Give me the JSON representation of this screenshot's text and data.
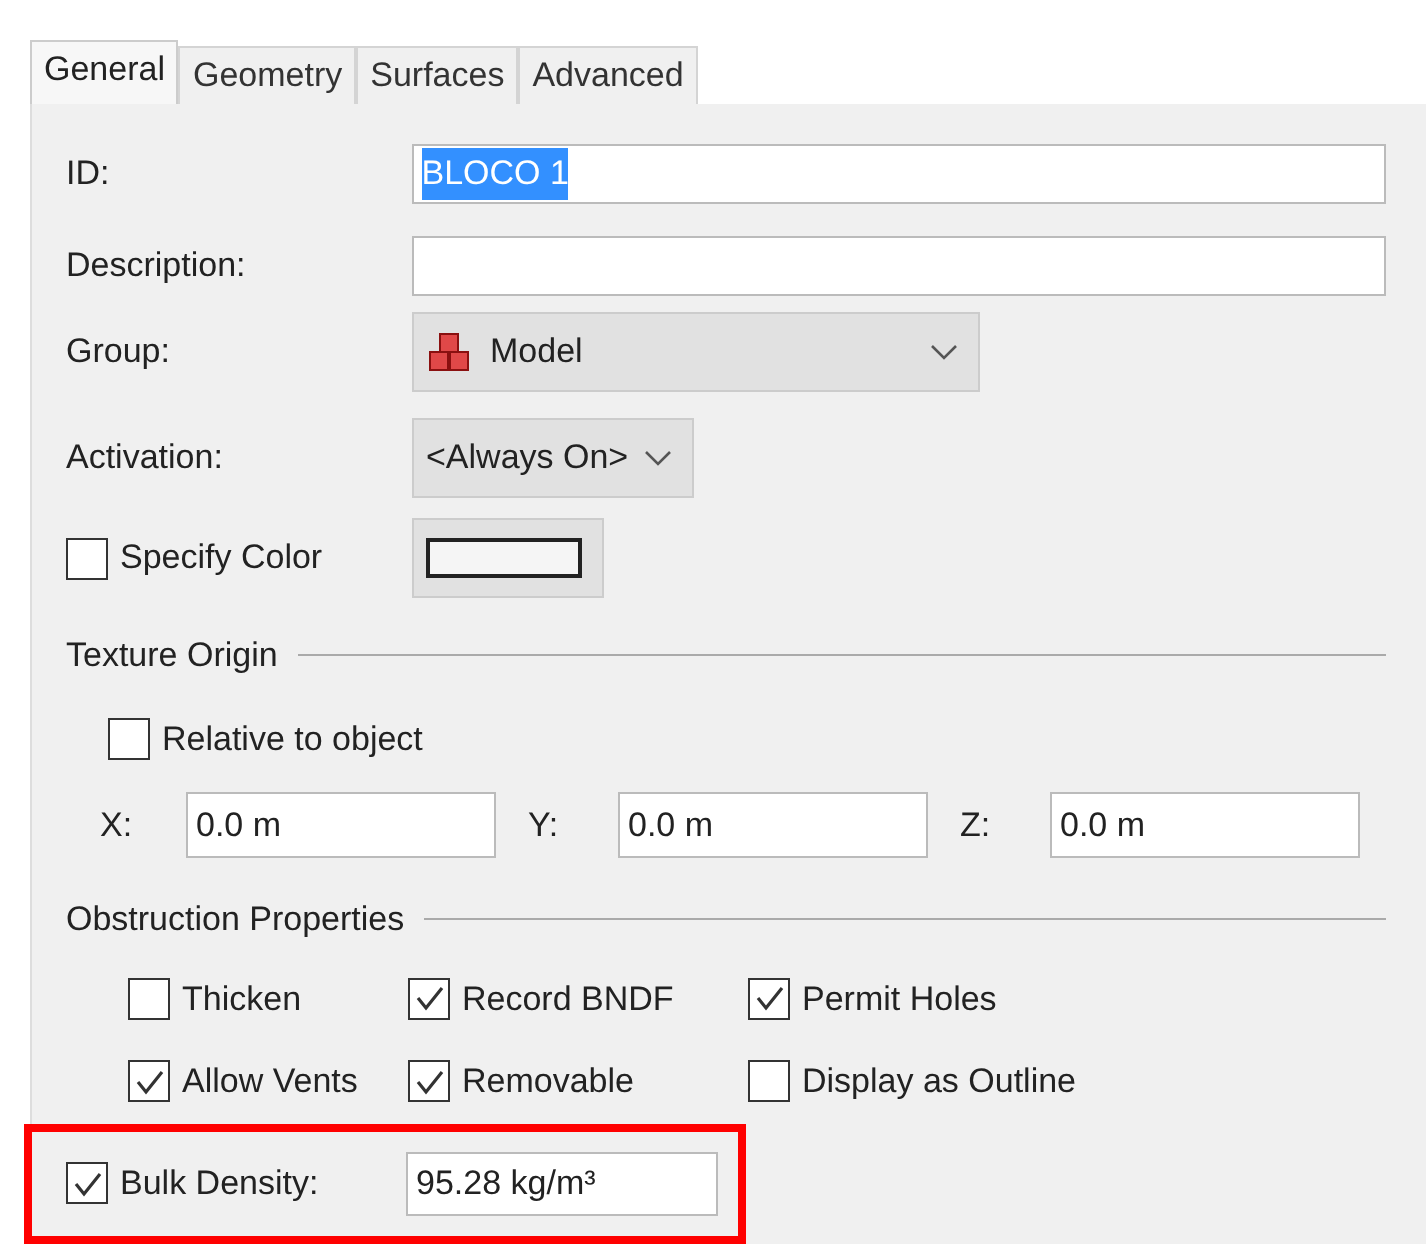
{
  "tabs": [
    {
      "label": "General",
      "selected": true
    },
    {
      "label": "Geometry",
      "selected": false
    },
    {
      "label": "Surfaces",
      "selected": false
    },
    {
      "label": "Advanced",
      "selected": false
    }
  ],
  "id": {
    "label": "ID:",
    "value": "BLOCO 1",
    "value_selected": true
  },
  "description": {
    "label": "Description:"
  },
  "group": {
    "label": "Group:",
    "value": "Model"
  },
  "activation": {
    "label": "Activation:",
    "value": "<Always On>"
  },
  "specify_color": {
    "label": "Specify Color",
    "checked": false
  },
  "texture_origin": {
    "title": "Texture Origin",
    "relative": {
      "label": "Relative to object",
      "checked": false
    },
    "coords": [
      {
        "label": "X:",
        "value": "0.0 m"
      },
      {
        "label": "Y:",
        "value": "0.0 m"
      },
      {
        "label": "Z:",
        "value": "0.0 m"
      }
    ]
  },
  "obstruction": {
    "title": "Obstruction Properties",
    "options": [
      {
        "label": "Thicken",
        "checked": false
      },
      {
        "label": "Record BNDF",
        "checked": true
      },
      {
        "label": "Permit Holes",
        "checked": true
      },
      {
        "label": "Allow Vents",
        "checked": true
      },
      {
        "label": "Removable",
        "checked": true
      },
      {
        "label": "Display as Outline",
        "checked": false
      }
    ]
  },
  "bulk_density": {
    "label": "Bulk Density:",
    "checked": true,
    "value": "95.28 kg/m³",
    "highlighted": true
  }
}
